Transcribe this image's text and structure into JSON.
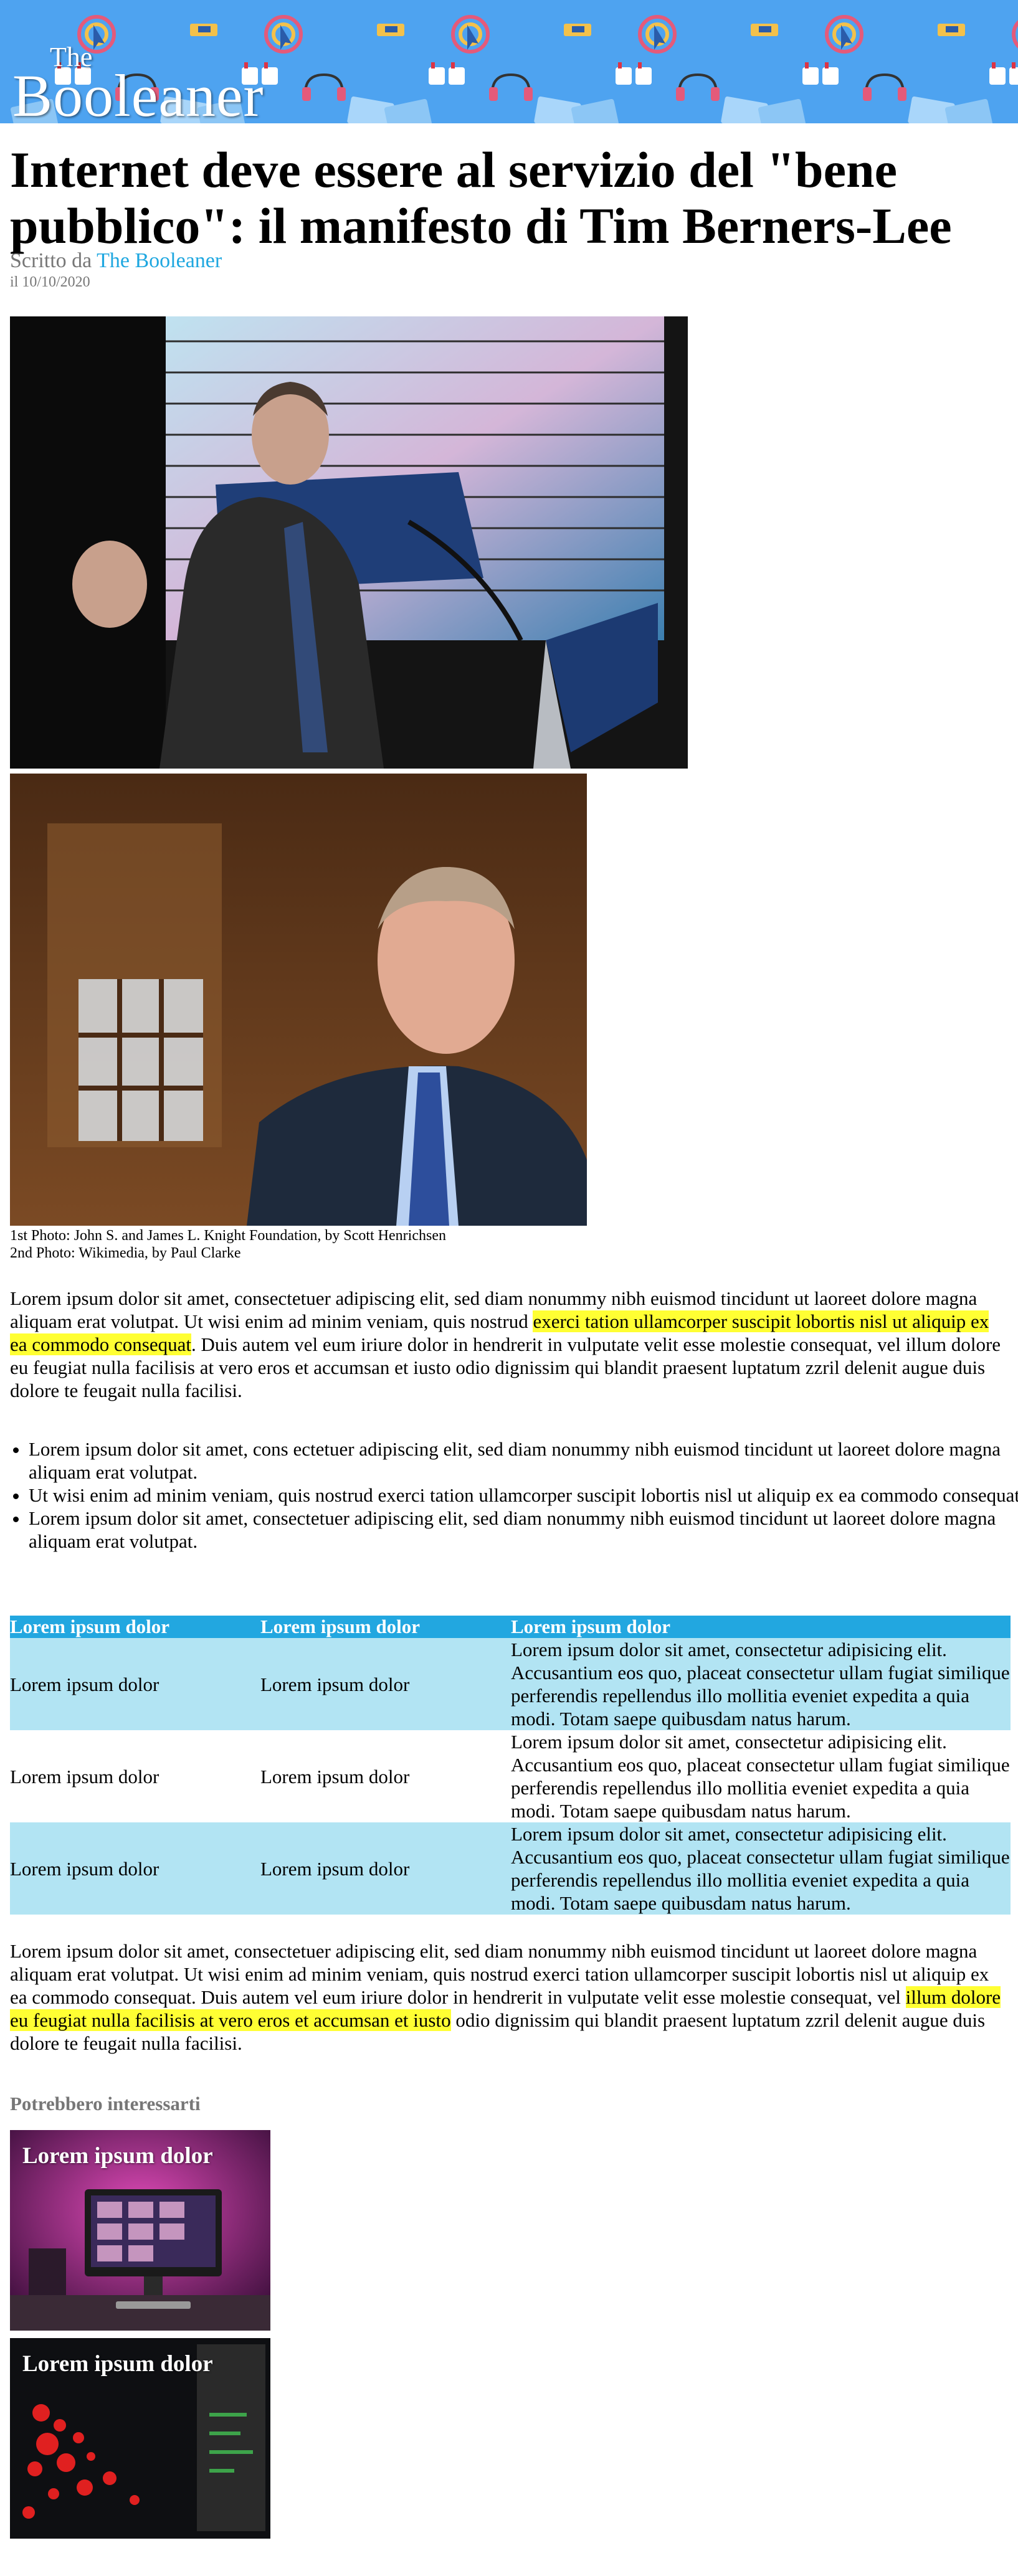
{
  "header": {
    "logo_the": "The",
    "logo_main": "Booleaner",
    "bg_color": "#4ea3f0"
  },
  "article": {
    "title": "Internet deve essere al servizio del \"bene pubblico\":  il manifesto di Tim Berners-Lee",
    "byline_prefix": "Scritto da ",
    "author": "The Booleaner",
    "date": "il 10/10/2020",
    "caption_line1": "1st Photo: John S. and James L. Knight Foundation, by Scott Henrichsen",
    "caption_line2": "2nd Photo: Wikimedia, by Paul Clarke",
    "para1_part1": "Lorem ipsum dolor sit amet, consectetuer adipiscing elit, sed diam nonummy nibh euismod tincidunt ut laoreet dolore magna aliquam erat volutpat. Ut wisi enim ad minim veniam, quis nostrud ",
    "para1_highlight": "exerci tation ullamcorper suscipit lobortis nisl ut aliquip ex ea commodo consequat",
    "para1_part2": ". Duis autem vel eum iriure dolor in hendrerit in vulputate velit esse molestie consequat, vel illum dolore eu feugiat nulla facilisis at vero eros et accumsan et iusto odio dignissim qui blandit praesent luptatum zzril delenit augue duis dolore te feugait nulla facilisi.",
    "bullets": [
      "Lorem ipsum dolor sit amet, cons ectetuer adipiscing elit, sed diam nonummy nibh euismod tincidunt ut laoreet dolore magna aliquam erat volutpat.",
      "Ut wisi enim ad minim veniam, quis nostrud exerci tation ullamcorper suscipit lobortis nisl ut aliquip ex ea commodo consequat.",
      "Lorem ipsum dolor sit amet, consectetuer adipiscing elit, sed diam nonummy nibh euismod tincidunt ut laoreet dolore magna aliquam erat volutpat."
    ],
    "para2_part1": "Lorem ipsum dolor sit amet, consectetuer adipiscing elit, sed diam nonummy nibh euismod tincidunt ut laoreet dolore magna aliquam erat volutpat. Ut wisi enim ad minim veniam, quis nostrud exerci tation ullamcorper suscipit lobortis nisl ut aliquip ex ea commodo consequat. Duis autem vel eum iriure dolor in hendrerit in vulputate velit esse molestie consequat, vel ",
    "para2_highlight": "illum dolore eu feugiat nulla facilisis at vero eros et accumsan et iusto",
    "para2_part2": " odio dignissim qui blandit praesent luptatum zzril delenit augue duis dolore te feugait nulla facilisi."
  },
  "table": {
    "headers": [
      "Lorem ipsum dolor",
      "Lorem ipsum dolor",
      "Lorem ipsum dolor"
    ],
    "rows": [
      [
        "Lorem ipsum dolor",
        "Lorem ipsum dolor",
        "Lorem ipsum dolor sit amet, consectetur adipisicing elit. Accusantium eos quo, placeat consectetur ullam fugiat similique perferendis repellendus illo mollitia eveniet expedita a quia modi. Totam saepe quibusdam natus harum."
      ],
      [
        "Lorem ipsum dolor",
        "Lorem ipsum dolor",
        "Lorem ipsum dolor sit amet, consectetur adipisicing elit. Accusantium eos quo, placeat consectetur ullam fugiat similique perferendis repellendus illo mollitia eveniet expedita a quia modi. Totam saepe quibusdam natus harum."
      ],
      [
        "Lorem ipsum dolor",
        "Lorem ipsum dolor",
        "Lorem ipsum dolor sit amet, consectetur adipisicing elit. Accusantium eos quo, placeat consectetur ullam fugiat similique perferendis repellendus illo mollitia eveniet expedita a quia modi. Totam saepe quibusdam natus harum."
      ]
    ],
    "header_color": "#22a7e0",
    "stripe_color": "#b2e4f3"
  },
  "related": {
    "title": "Potrebbero interessarti",
    "cards": [
      {
        "title": "Lorem ipsum dolor"
      },
      {
        "title": "Lorem ipsum dolor"
      }
    ]
  },
  "colors": {
    "highlight": "#ffff33",
    "link": "#1ea7e0",
    "muted": "#777777"
  }
}
